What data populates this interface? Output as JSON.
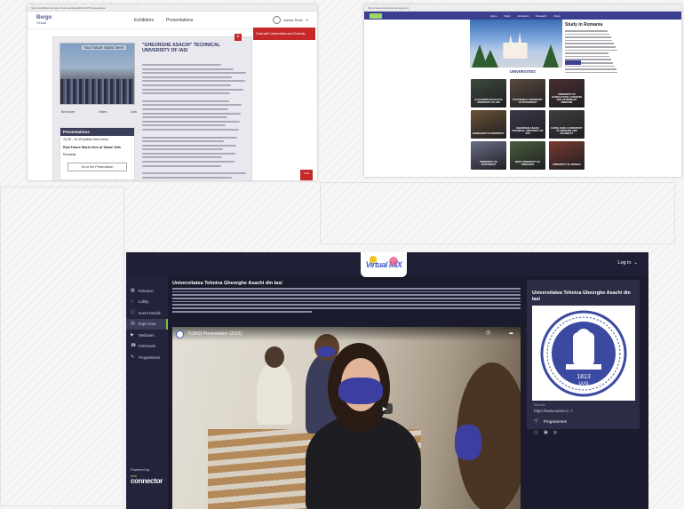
{
  "shot1": {
    "url": "https://exhibition.bergo-virtual.events/exhibitor/UTI/presentation",
    "logo_line1": "Bergo",
    "logo_line2": "Virtual",
    "nav": [
      "Exhibitors",
      "Presentations"
    ],
    "user": "Alexia Timic",
    "red_button": "Chat with Universities and Schools",
    "photo_caption": "Your future starts here!",
    "links": [
      "Brochure",
      "Video",
      "Link"
    ],
    "title": "\"GHEORGHE ASACHI\" TECHNICAL UNIVERSITY OF IASI",
    "presentations_header": "Presentations",
    "presentation_time": "10:30 - 10:15 (Italian time zone)",
    "presentation_name": "Real Future Starts Here at Tuiasi! 20th",
    "presentation_place": "Romania",
    "presentation_button": "Go to the Presentation",
    "side_button": "Chat"
  },
  "shot2": {
    "url": "https://www.studyinromania.gov.ro/",
    "nav": [
      "Home",
      "Study",
      "Admission",
      "Research",
      "About"
    ],
    "study_title": "Study in Romania",
    "universities_header": "UNIVERSITIES",
    "tiles": [
      {
        "label": "Alexandru Ioan Cuza University of Iasi",
        "color": "#3e4a3c"
      },
      {
        "label": "Politehnica University of Bucharest",
        "color": "#5a4a3e"
      },
      {
        "label": "University of Agricultural Sciences and Veterinary Medicine",
        "color": "#4a2e2e"
      },
      {
        "label": "Babes-Bolyai University",
        "color": "#6a5234"
      },
      {
        "label": "Gheorghe Asachi Technical University of Iasi",
        "color": "#3c3848"
      },
      {
        "label": "Carol Davila University of Medicine and Pharmacy",
        "color": "#3f3f3f"
      },
      {
        "label": "University of Bucharest",
        "color": "#6b6e86"
      },
      {
        "label": "West University of Timisoara",
        "color": "#4a5d3c"
      },
      {
        "label": "University of Oradea",
        "color": "#7a3a2e"
      }
    ]
  },
  "shot3": {
    "logo": "Virtual MIX",
    "login": "Log in",
    "sidebar": [
      {
        "label": "Entrance",
        "icon": "▦"
      },
      {
        "label": "Lobby",
        "icon": "⌂"
      },
      {
        "label": "Event Details",
        "icon": "ⓘ"
      },
      {
        "label": "Expo Area",
        "icon": "▤"
      },
      {
        "label": "Webinars",
        "icon": "▶"
      },
      {
        "label": "Interviews",
        "icon": "☎"
      },
      {
        "label": "Programmes",
        "icon": "✎"
      }
    ],
    "active_index": 3,
    "powered_by": "Powered by:",
    "connector_line1": "mix",
    "connector_line2": "connector",
    "title": "Universitatea Tehnica Gheorghe Asachi din Iasi",
    "video_title": "TUIASI Presentation (2021)",
    "panel_title": "Universitatea Tehnica Gheorghe Asachi din Iasi",
    "seal_year": "1813",
    "seal_city": "IASI",
    "website_label": "Website",
    "website": "https://www.tuiasi.ro",
    "programmes": "Programmes",
    "accent": "#7bc043",
    "seal_color": "#3b4aa0"
  }
}
